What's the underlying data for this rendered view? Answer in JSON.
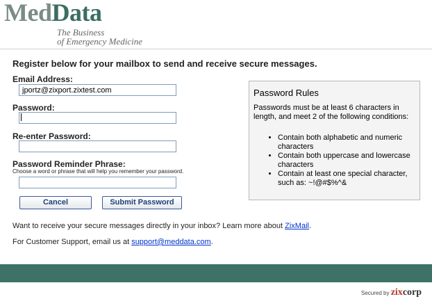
{
  "header": {
    "logo_part1": "Med",
    "logo_part2": "Data",
    "tagline_line1": "The Business",
    "tagline_line2": "of Emergency Medicine"
  },
  "form": {
    "heading": "Register below for your mailbox to send and receive secure messages.",
    "email_label": "Email Address:",
    "email_value": "jportz@zixport.zixtest.com",
    "password_label": "Password:",
    "password_value": "",
    "reenter_label": "Re-enter Password:",
    "reenter_value": "",
    "reminder_label": "Password Reminder Phrase:",
    "reminder_hint": "Choose a word or phrase that will help you remember your password.",
    "reminder_value": "",
    "cancel_label": "Cancel",
    "submit_label": "Submit Password"
  },
  "rules": {
    "title": "Password Rules",
    "intro": "Passwords must be at least 6 characters in length, and meet 2 of the following conditions:",
    "items": [
      "Contain both alphabetic and numeric characters",
      "Contain both uppercase and lowercase characters",
      "Contain at least one special character, such as: ~!@#$%^&"
    ]
  },
  "footer": {
    "zixmail_text": "Want to receive your secure messages directly in your inbox? Learn more about ",
    "zixmail_link": "ZixMail",
    "zixmail_end": ".",
    "support_text": "For Customer Support, email us at ",
    "support_link": "support@meddata.com",
    "support_end": ".",
    "secured_by": "Secured by",
    "zix_part1": "zix",
    "zix_part2": "corp"
  },
  "colors": {
    "brand_green": "#3e7266",
    "link": "#0033cc",
    "zix_red": "#b33a2a"
  }
}
